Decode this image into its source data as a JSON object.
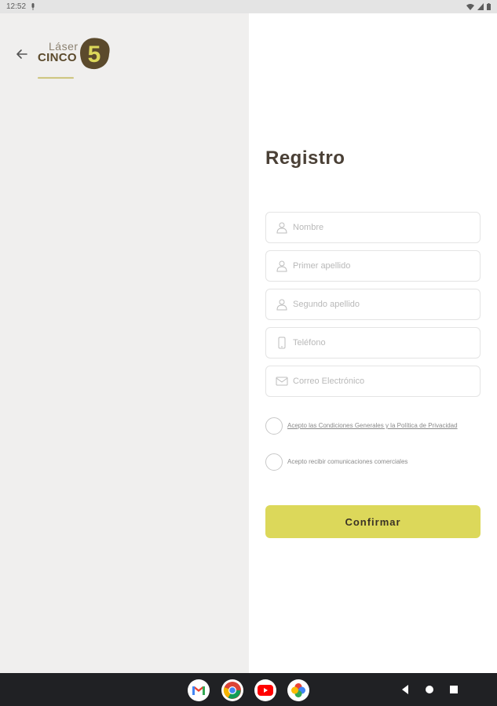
{
  "status_bar": {
    "time": "12:52"
  },
  "form": {
    "title": "Registro",
    "fields": [
      {
        "placeholder": "Nombre",
        "icon": "person-icon"
      },
      {
        "placeholder": "Primer apellido",
        "icon": "person-icon"
      },
      {
        "placeholder": "Segundo apellido",
        "icon": "person-icon"
      },
      {
        "placeholder": "Teléfono",
        "icon": "phone-icon"
      },
      {
        "placeholder": "Correo Electrónico",
        "icon": "mail-icon"
      }
    ],
    "terms_label": "Acepto las Condiciones Generales y la Política de Privacidad",
    "comms_label": "Acepto recibir comunicaciones comerciales",
    "confirm_label": "Confirmar"
  },
  "logo": {
    "line1": "Láser",
    "line2": "CINCO",
    "digit": "5"
  },
  "dock": [
    "gmail-icon",
    "chrome-icon",
    "youtube-icon",
    "photos-icon"
  ],
  "colors": {
    "accent": "#dcd85a",
    "brand_dark": "#5b4a2c",
    "title": "#4a4036"
  }
}
